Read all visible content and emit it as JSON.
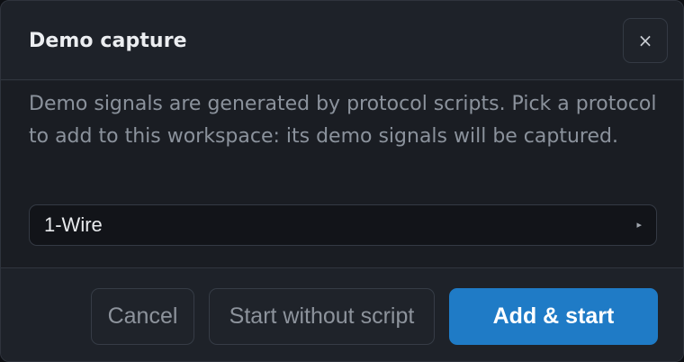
{
  "dialog": {
    "title": "Demo capture",
    "close_label": "×",
    "description": "Demo signals are generated by protocol scripts. Pick a protocol to add to this workspace: its demo signals will be captured.",
    "protocol_select": {
      "selected": "1-Wire",
      "arrow": "▸"
    },
    "buttons": {
      "cancel": "Cancel",
      "start_without_script": "Start without script",
      "add_and_start": "Add & start"
    }
  },
  "colors": {
    "dialog_background": "#1e2229",
    "body_background": "#1a1d23",
    "primary_accent": "#1f7bc6",
    "muted_text": "#8b929c"
  }
}
